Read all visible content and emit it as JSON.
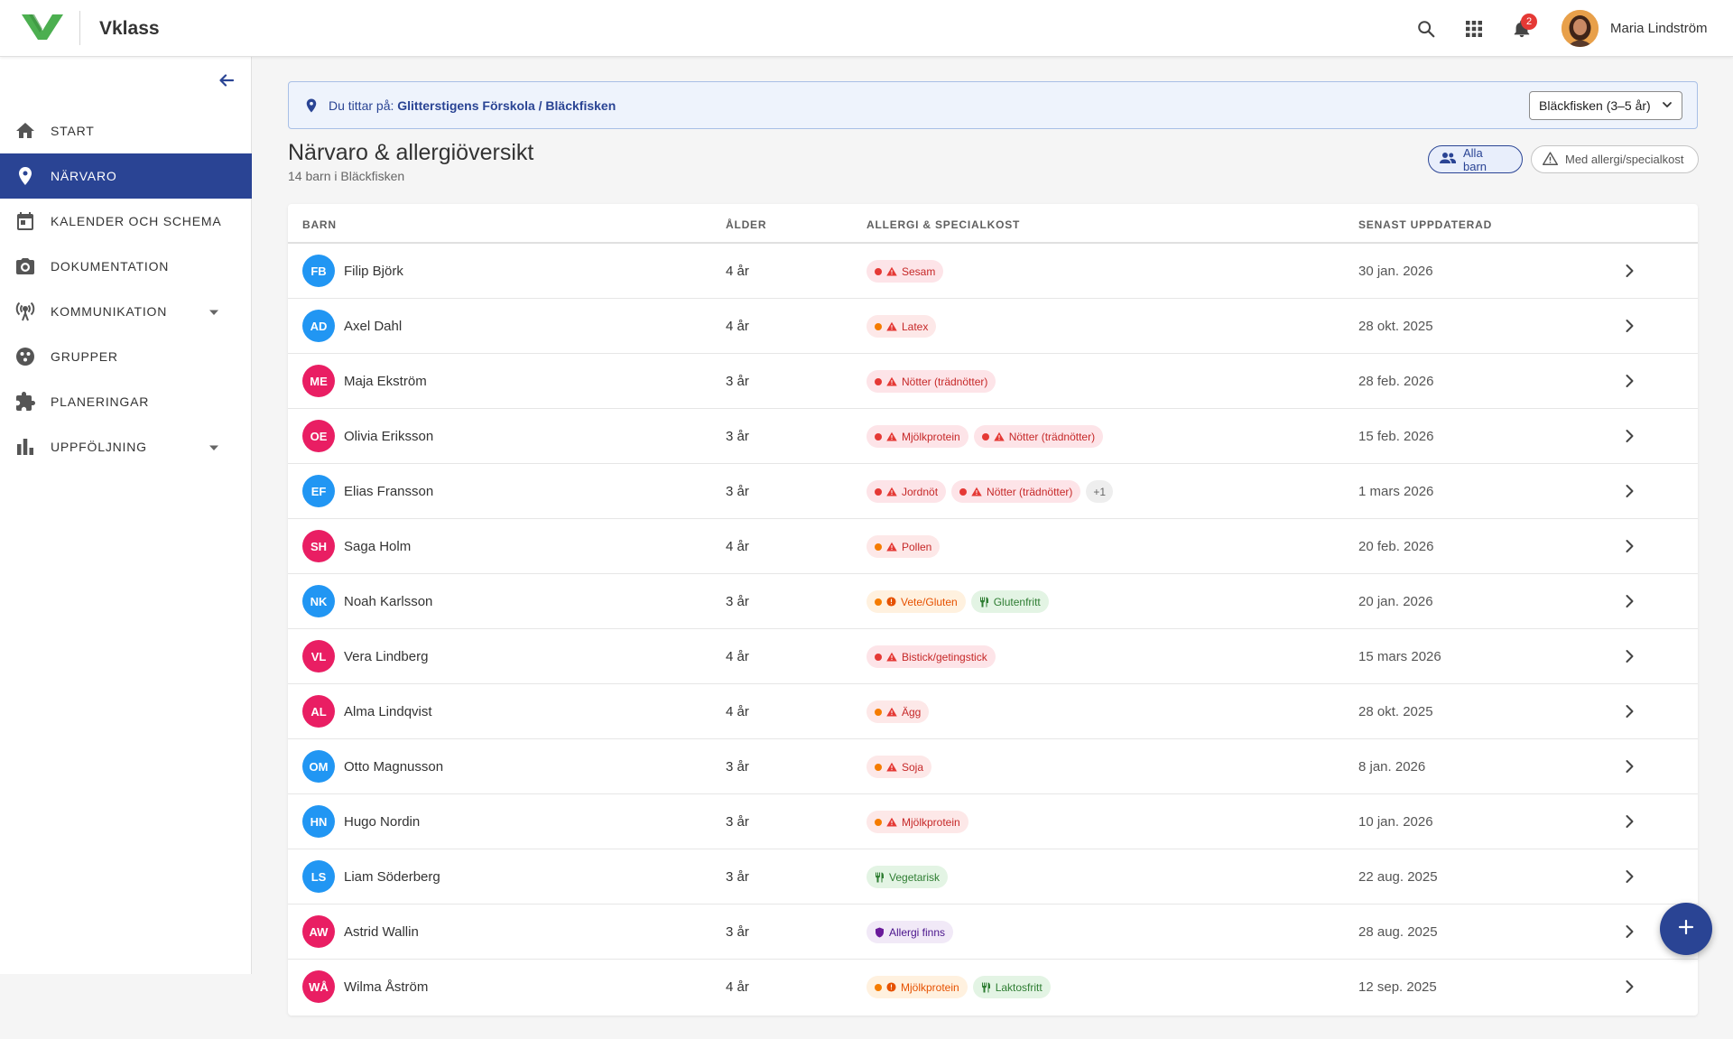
{
  "header": {
    "app_name": "Vklass",
    "notification_count": "2",
    "user_name": "Maria Lindström"
  },
  "sidebar": {
    "items": [
      {
        "label": "START",
        "icon": "home-icon"
      },
      {
        "label": "NÄRVARO",
        "icon": "location-pin-icon",
        "active": true
      },
      {
        "label": "KALENDER OCH SCHEMA",
        "icon": "calendar-icon"
      },
      {
        "label": "DOKUMENTATION",
        "icon": "camera-icon"
      },
      {
        "label": "KOMMUNIKATION",
        "icon": "broadcast-icon",
        "has_submenu": true
      },
      {
        "label": "GRUPPER",
        "icon": "groups-icon"
      },
      {
        "label": "PLANERINGAR",
        "icon": "puzzle-icon"
      },
      {
        "label": "UPPFÖLJNING",
        "icon": "bar-chart-icon",
        "has_submenu": true
      }
    ]
  },
  "context": {
    "prefix": "Du tittar på:",
    "school": "Glitterstigens Förskola",
    "separator": "/",
    "group": "Bläckfisken",
    "select_value": "Bläckfisken (3–5 år)"
  },
  "page": {
    "title": "Närvaro & allergiöversikt",
    "subtitle": "14 barn i Bläckfisken",
    "filter_all": "Alla barn",
    "filter_allergy": "Med allergi/specialkost"
  },
  "table": {
    "headers": {
      "child": "BARN",
      "age": "ÅLDER",
      "allergy": "ALLERGI & SPECIALKOST",
      "updated": "SENAST UPPDATERAD"
    },
    "rows": [
      {
        "initials": "FB",
        "color": "#2196f3",
        "name": "Filip Björk",
        "age": "4 år",
        "updated": "30 jan. 2026",
        "tags": [
          {
            "kind": "severe",
            "label": "Sesam"
          }
        ]
      },
      {
        "initials": "AD",
        "color": "#2196f3",
        "name": "Axel Dahl",
        "age": "4 år",
        "updated": "28 okt. 2025",
        "tags": [
          {
            "kind": "moderate",
            "label": "Latex"
          }
        ]
      },
      {
        "initials": "ME",
        "color": "#e91e63",
        "name": "Maja Ekström",
        "age": "3 år",
        "updated": "28 feb. 2026",
        "tags": [
          {
            "kind": "severe",
            "label": "Nötter (trädnötter)"
          }
        ]
      },
      {
        "initials": "OE",
        "color": "#e91e63",
        "name": "Olivia Eriksson",
        "age": "3 år",
        "updated": "15 feb. 2026",
        "tags": [
          {
            "kind": "severe",
            "label": "Mjölkprotein"
          },
          {
            "kind": "severe",
            "label": "Nötter (trädnötter)"
          }
        ]
      },
      {
        "initials": "EF",
        "color": "#2196f3",
        "name": "Elias Fransson",
        "age": "3 år",
        "updated": "1 mars 2026",
        "tags": [
          {
            "kind": "severe",
            "label": "Jordnöt"
          },
          {
            "kind": "severe",
            "label": "Nötter (trädnötter)"
          },
          {
            "kind": "more",
            "label": "+1"
          }
        ]
      },
      {
        "initials": "SH",
        "color": "#e91e63",
        "name": "Saga Holm",
        "age": "4 år",
        "updated": "20 feb. 2026",
        "tags": [
          {
            "kind": "moderate",
            "label": "Pollen"
          }
        ]
      },
      {
        "initials": "NK",
        "color": "#2196f3",
        "name": "Noah Karlsson",
        "age": "3 år",
        "updated": "20 jan. 2026",
        "tags": [
          {
            "kind": "intol",
            "label": "Vete/Gluten"
          },
          {
            "kind": "diet",
            "label": "Glutenfritt"
          }
        ]
      },
      {
        "initials": "VL",
        "color": "#e91e63",
        "name": "Vera Lindberg",
        "age": "4 år",
        "updated": "15 mars 2026",
        "tags": [
          {
            "kind": "severe",
            "label": "Bistick/getingstick"
          }
        ]
      },
      {
        "initials": "AL",
        "color": "#e91e63",
        "name": "Alma Lindqvist",
        "age": "4 år",
        "updated": "28 okt. 2025",
        "tags": [
          {
            "kind": "moderate",
            "label": "Ägg"
          }
        ]
      },
      {
        "initials": "OM",
        "color": "#2196f3",
        "name": "Otto Magnusson",
        "age": "3 år",
        "updated": "8 jan. 2026",
        "tags": [
          {
            "kind": "moderate",
            "label": "Soja"
          }
        ]
      },
      {
        "initials": "HN",
        "color": "#2196f3",
        "name": "Hugo Nordin",
        "age": "3 år",
        "updated": "10 jan. 2026",
        "tags": [
          {
            "kind": "moderate",
            "label": "Mjölkprotein"
          }
        ]
      },
      {
        "initials": "LS",
        "color": "#2196f3",
        "name": "Liam Söderberg",
        "age": "3 år",
        "updated": "22 aug. 2025",
        "tags": [
          {
            "kind": "diet",
            "label": "Vegetarisk"
          }
        ]
      },
      {
        "initials": "AW",
        "color": "#e91e63",
        "name": "Astrid Wallin",
        "age": "3 år",
        "updated": "28 aug. 2025",
        "tags": [
          {
            "kind": "info",
            "label": "Allergi finns"
          }
        ]
      },
      {
        "initials": "WÅ",
        "color": "#e91e63",
        "name": "Wilma Åström",
        "age": "4 år",
        "updated": "12 sep. 2025",
        "tags": [
          {
            "kind": "intol",
            "label": "Mjölkprotein"
          },
          {
            "kind": "diet",
            "label": "Laktosfritt"
          }
        ]
      }
    ]
  },
  "colors": {
    "brand_green": "#4caf50",
    "primary": "#2a4494",
    "boy_avatar": "#2196f3",
    "girl_avatar": "#e91e63",
    "notification": "#e53935"
  }
}
